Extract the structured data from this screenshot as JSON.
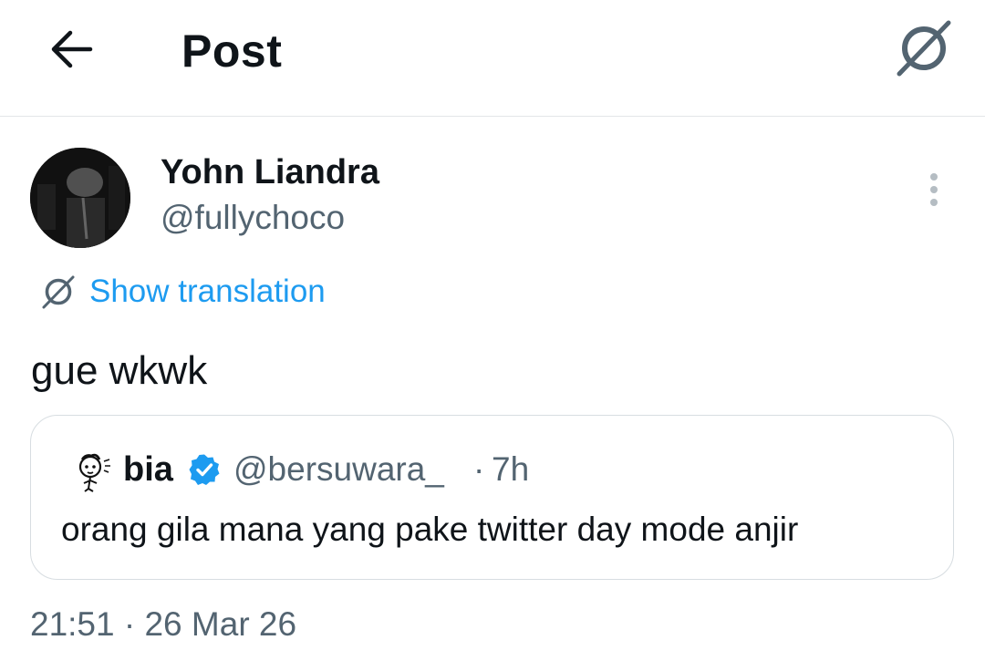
{
  "header": {
    "title": "Post",
    "back_icon": "arrow-left-icon",
    "translate_icon": "translate-icon"
  },
  "post": {
    "author": {
      "display_name": "Yohn Liandra",
      "handle": "@fullychoco"
    },
    "show_translation_label": "Show translation",
    "text": "gue wkwk",
    "time": "21:51",
    "separator": " · ",
    "date": "26 Mar 26"
  },
  "quote": {
    "author_name": "bia",
    "handle": "@bersuwara_",
    "separator": "·",
    "time": "7h",
    "text": "orang gila mana yang pake twitter day mode anjir"
  },
  "colors": {
    "accent": "#1d9bf0",
    "secondary_text": "#536471",
    "primary_text": "#0f1419",
    "border": "#d7dde1"
  }
}
